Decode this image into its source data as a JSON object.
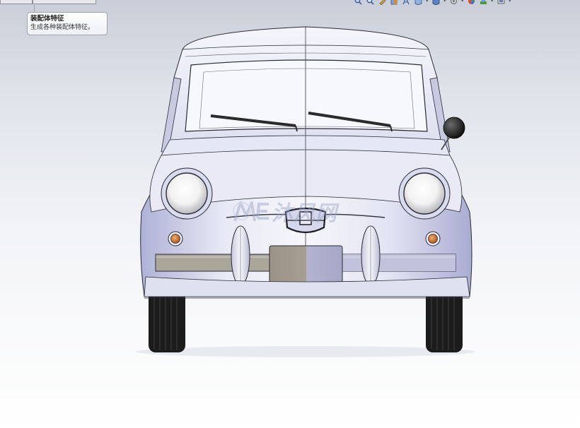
{
  "tooltip": {
    "title": "装配体特征",
    "description": "生成各种装配体特征。"
  },
  "view_toolbar": {
    "buttons": [
      {
        "icon": "zoom-to-fit-icon",
        "dropdown": false
      },
      {
        "icon": "zoom-to-area-icon",
        "dropdown": false
      },
      {
        "icon": "previous-view-icon",
        "dropdown": false
      },
      {
        "icon": "section-view-icon",
        "dropdown": false
      },
      {
        "icon": "dynamic-annotation-icon",
        "dropdown": false
      },
      {
        "icon": "view-orientation-icon",
        "dropdown": true
      },
      {
        "icon": "display-style-icon",
        "dropdown": true
      },
      {
        "icon": "hide-show-items-icon",
        "dropdown": true
      },
      {
        "icon": "edit-appearance-icon",
        "dropdown": true
      },
      {
        "icon": "apply-scene-icon",
        "dropdown": true
      },
      {
        "icon": "view-settings-icon",
        "dropdown": true
      }
    ]
  },
  "watermark": {
    "text": "沐风网",
    "logo": "ME"
  },
  "colors": {
    "body_paint": "#e4e6f4",
    "body_shade": "#b9bcdc",
    "outline": "#2a2a35",
    "tire": "#1c1c1c",
    "turn_signal": "#c9762a",
    "bumper_bar": "#a09a8a",
    "plate": "#a9a198",
    "mirror": "#1a1a1a"
  }
}
